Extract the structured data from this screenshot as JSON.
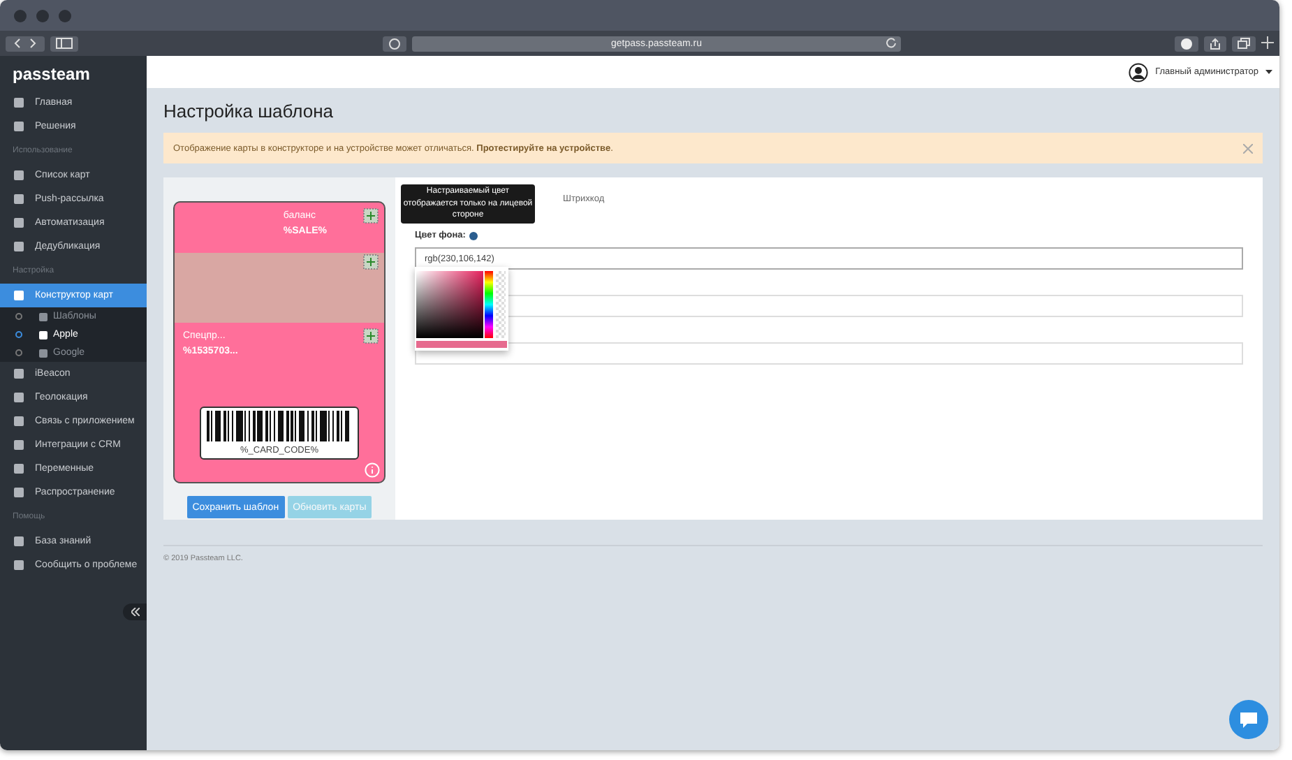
{
  "browser": {
    "url": "getpass.passteam.ru"
  },
  "sidebar": {
    "logo": "passteam",
    "items": [
      {
        "kind": "item",
        "label": "Главная",
        "selected": false
      },
      {
        "kind": "item",
        "label": "Решения",
        "selected": false
      },
      {
        "kind": "section",
        "label": "Использование"
      },
      {
        "kind": "item",
        "label": "Список карт",
        "selected": false
      },
      {
        "kind": "item",
        "label": "Push-рассылка",
        "selected": false
      },
      {
        "kind": "item",
        "label": "Автоматизация",
        "selected": false
      },
      {
        "kind": "item",
        "label": "Дедубликация",
        "selected": false
      },
      {
        "kind": "section",
        "label": "Настройка"
      },
      {
        "kind": "item",
        "label": "Конструктор карт",
        "selected": true
      },
      {
        "kind": "subitem",
        "label": "Шаблоны",
        "selected": false
      },
      {
        "kind": "subitem",
        "label": "Apple",
        "selected": true
      },
      {
        "kind": "subitem",
        "label": "Google",
        "selected": false
      },
      {
        "kind": "item",
        "label": "iBeacon",
        "selected": false
      },
      {
        "kind": "item",
        "label": "Геолокация",
        "selected": false
      },
      {
        "kind": "item",
        "label": "Связь с приложением",
        "selected": false
      },
      {
        "kind": "item",
        "label": "Интеграции с CRM",
        "selected": false
      },
      {
        "kind": "item",
        "label": "Переменные",
        "selected": false
      },
      {
        "kind": "item",
        "label": "Распространение",
        "selected": false
      },
      {
        "kind": "section",
        "label": "Помощь"
      },
      {
        "kind": "item",
        "label": "База знаний",
        "selected": false
      },
      {
        "kind": "item",
        "label": "Сообщить о проблеме",
        "selected": false
      }
    ]
  },
  "header": {
    "user": "Главный администратор"
  },
  "page": {
    "title": "Настройка шаблона",
    "alert": "Отображение карты в конструкторе и на устройстве может отличаться. **Протестируйте на устройстве**."
  },
  "card": {
    "field_1_label": "баланс",
    "field_1_value": "%SALE%",
    "field_2_label": "Спецпр...",
    "field_2_value": "%1535703...",
    "barcode_text": "%_CARD_CODE%"
  },
  "buttons": [
    {
      "label": "Сохранить шаблон",
      "disabled": false
    },
    {
      "label": "Обновить карты",
      "disabled": true
    }
  ],
  "form": {
    "tab": "Штрихкод",
    "tooltip": "Настраиваемый цвет отображается только на лицевой стороне",
    "color_label": "Цвет фона:",
    "color_value": "rgb(230,106,142)"
  },
  "footer": "© 2019 Passteam LLC."
}
